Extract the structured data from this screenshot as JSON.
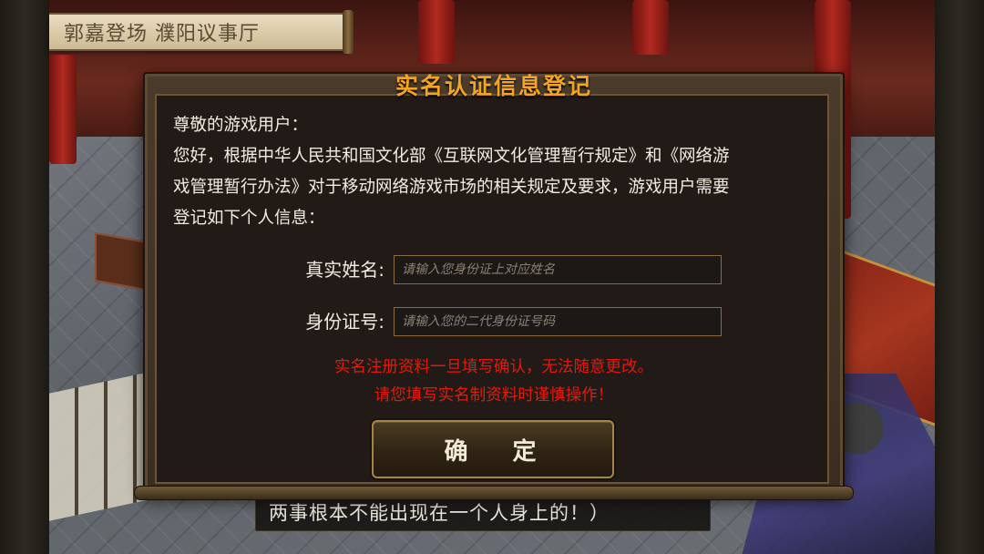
{
  "location": {
    "text": "郭嘉登场 濮阳议事厅"
  },
  "dialog": {
    "title": "实名认证信息登记",
    "notice": [
      "尊敬的游戏用户：",
      "您好，根据中华人民共和国文化部《互联网文化管理暂行规定》和《网络游",
      "戏管理暂行办法》对于移动网络游戏市场的相关规定及要求，游戏用户需要",
      "登记如下个人信息："
    ],
    "name_field": {
      "label": "真实姓名:",
      "placeholder": "请输入您身份证上对应姓名",
      "value": ""
    },
    "id_field": {
      "label": "身份证号:",
      "placeholder": "请输入您的二代身份证号码",
      "value": ""
    },
    "warnings": [
      "实名注册资料一旦填写确认，无法随意更改。",
      "请您填写实名制资料时谨慎操作！"
    ],
    "confirm_label": "确  定"
  },
  "subtitle": {
    "text": "两事根本不能出现在一个人身上的！）"
  },
  "colors": {
    "title": "#f2a521",
    "warning": "#e01a10",
    "panel_bg": "#221a16",
    "frame_border": "#8b6d3c"
  }
}
